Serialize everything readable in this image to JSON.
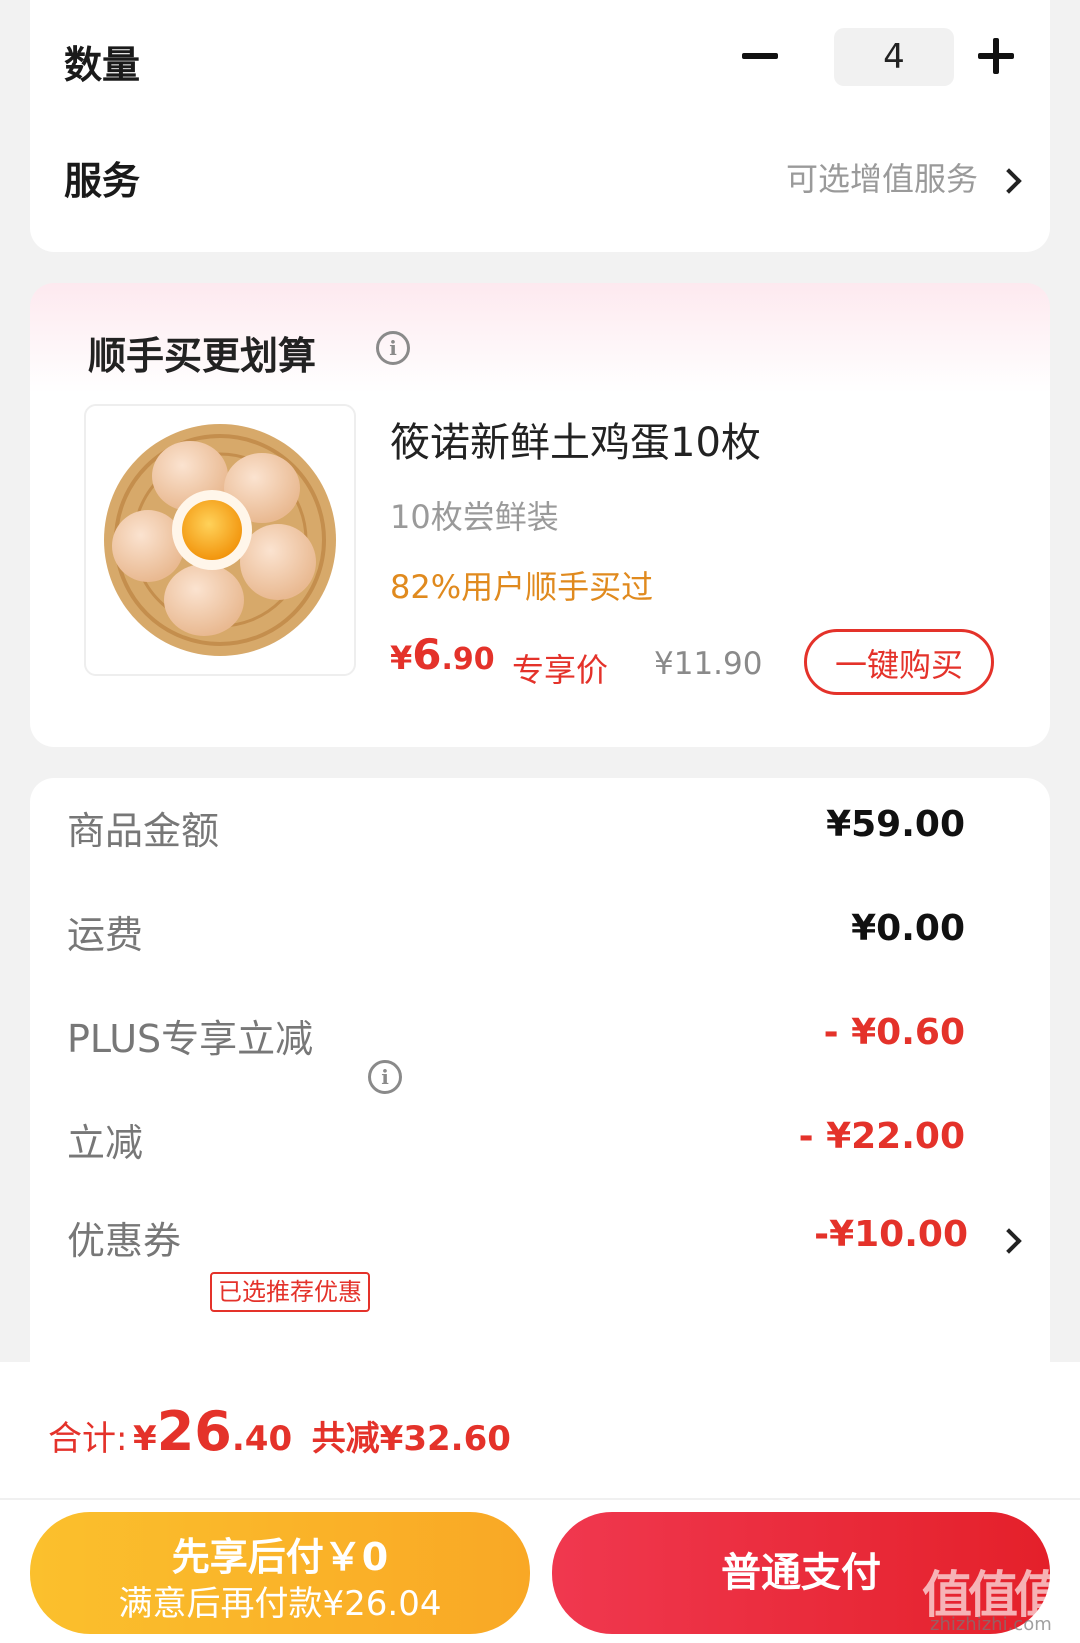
{
  "quantity_row": {
    "label": "数量",
    "value": "4"
  },
  "service_row": {
    "label": "服务",
    "hint": "可选增值服务"
  },
  "upsell": {
    "title": "顺手买更划算",
    "product": {
      "name": "筱诺新鲜土鸡蛋10枚",
      "subtitle": "10枚尝鲜装",
      "bought_rate": "82%用户顺手买过",
      "price_currency": "¥",
      "price_int": "6",
      "price_dec": ".90",
      "exclusive_label": "专享价",
      "original_price": "¥11.90",
      "buy_button": "一键购买"
    }
  },
  "summary": {
    "rows": [
      {
        "label": "商品金额",
        "value": "¥59.00"
      },
      {
        "label": "运费",
        "value": "¥0.00"
      },
      {
        "label": "PLUS专享立减",
        "value": "- ¥0.60"
      },
      {
        "label": "立减",
        "value": "- ¥22.00"
      },
      {
        "label": "优惠券",
        "tag": "已选推荐优惠",
        "value": "-¥10.00"
      }
    ]
  },
  "footer": {
    "total_label": "合计:",
    "total_currency": "¥",
    "total_int": "26",
    "total_dec": ".40",
    "saved": "共减¥32.60",
    "pay_later_line1": "先享后付￥0",
    "pay_later_line2": "满意后再付款¥26.04",
    "pay_normal": "普通支付",
    "watermark": "值值值",
    "watermark_sub": "zhizhizhi.com"
  },
  "colors": {
    "accent_red": "#e4322a",
    "orange": "#e08a1e",
    "yellow_button": "#fbc02d"
  },
  "icons": [
    "minus-icon",
    "plus-icon",
    "chevron-right-icon",
    "info-icon"
  ]
}
